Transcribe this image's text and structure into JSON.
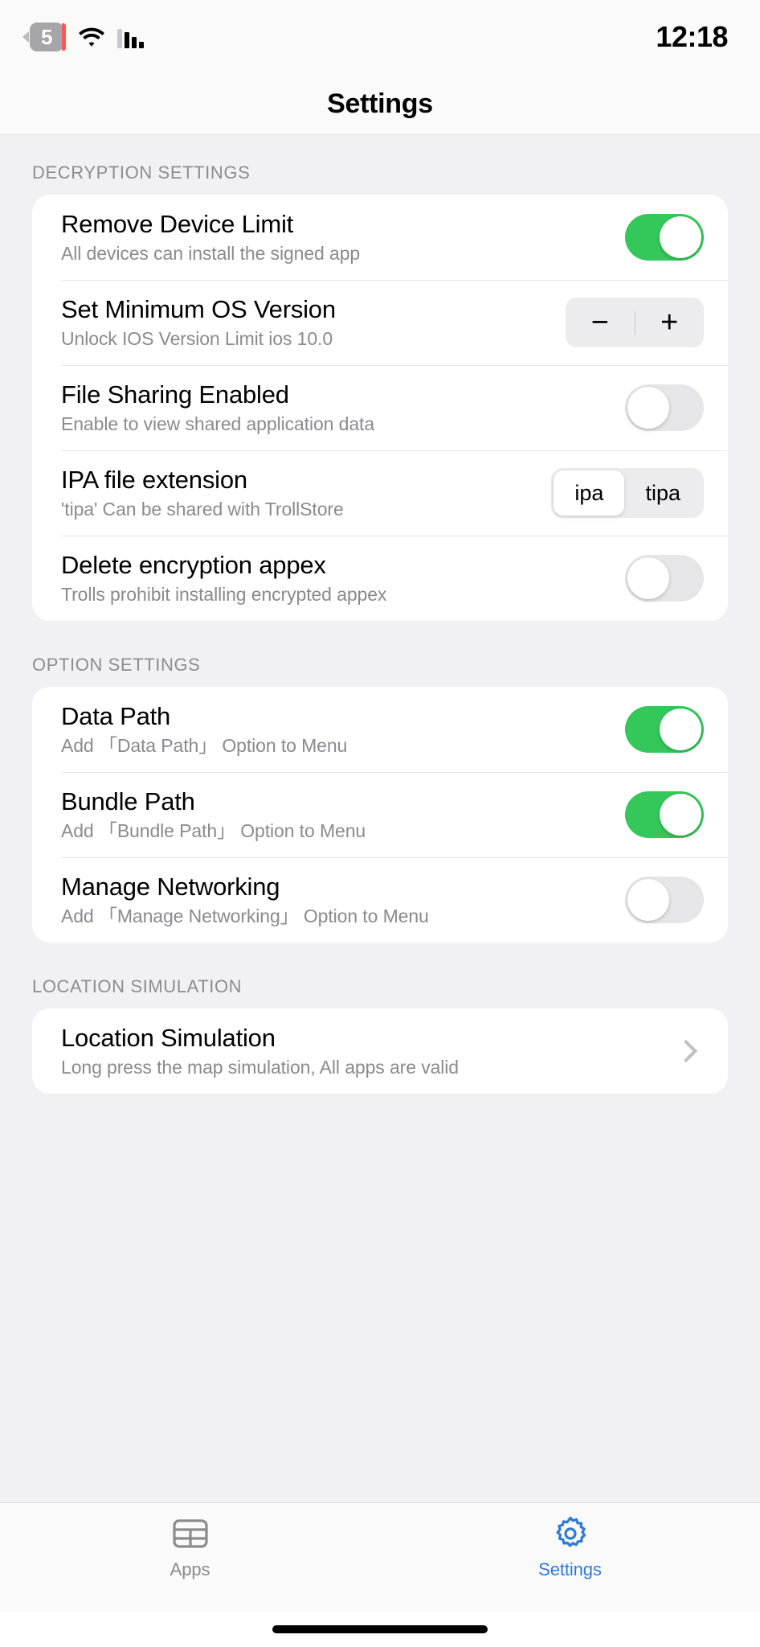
{
  "status_bar": {
    "back_badge": "5",
    "wifi_icon": "wifi-icon",
    "signal_icon": "cellular-signal-icon",
    "time": "12:18"
  },
  "nav": {
    "title": "Settings"
  },
  "colors": {
    "toggle_on": "#34c759",
    "toggle_off": "#e6e6e9",
    "accent": "#2f7ad6",
    "page_background": "#f1f0f5",
    "card_background": "#ffffff",
    "secondary_text": "#8a8a8f"
  },
  "sections": [
    {
      "header": "DECRYPTION SETTINGS",
      "rows": [
        {
          "title": "Remove Device Limit",
          "subtitle": "All devices can install the signed app",
          "control": "toggle",
          "value": "on"
        },
        {
          "title": "Set Minimum OS Version",
          "subtitle": "Unlock IOS Version Limit ios 10.0",
          "control": "stepper",
          "minus_label": "−",
          "plus_label": "+"
        },
        {
          "title": "File Sharing Enabled",
          "subtitle": "Enable to view shared application data",
          "control": "toggle",
          "value": "off"
        },
        {
          "title": "IPA file extension",
          "subtitle": "'tipa' Can be shared with TrollStore",
          "control": "segmented",
          "options": [
            "ipa",
            "tipa"
          ],
          "selected": "ipa"
        },
        {
          "title": "Delete encryption appex",
          "subtitle": "Trolls prohibit installing encrypted appex",
          "control": "toggle",
          "value": "off"
        }
      ]
    },
    {
      "header": "OPTION SETTINGS",
      "rows": [
        {
          "title": "Data Path",
          "subtitle": "Add 「Data Path」 Option to Menu",
          "control": "toggle",
          "value": "on"
        },
        {
          "title": "Bundle Path",
          "subtitle": "Add 「Bundle Path」 Option to Menu",
          "control": "toggle",
          "value": "on"
        },
        {
          "title": "Manage Networking",
          "subtitle": "Add 「Manage Networking」 Option to Menu",
          "control": "toggle",
          "value": "off"
        }
      ]
    },
    {
      "header": "LOCATION SIMULATION",
      "rows": [
        {
          "title": "Location Simulation",
          "subtitle": "Long press the map simulation, All apps are valid",
          "control": "chevron"
        }
      ]
    }
  ],
  "tab_bar": {
    "tabs": [
      {
        "label": "Apps",
        "icon": "grid-icon",
        "active": false
      },
      {
        "label": "Settings",
        "icon": "gear-icon",
        "active": true
      }
    ]
  }
}
